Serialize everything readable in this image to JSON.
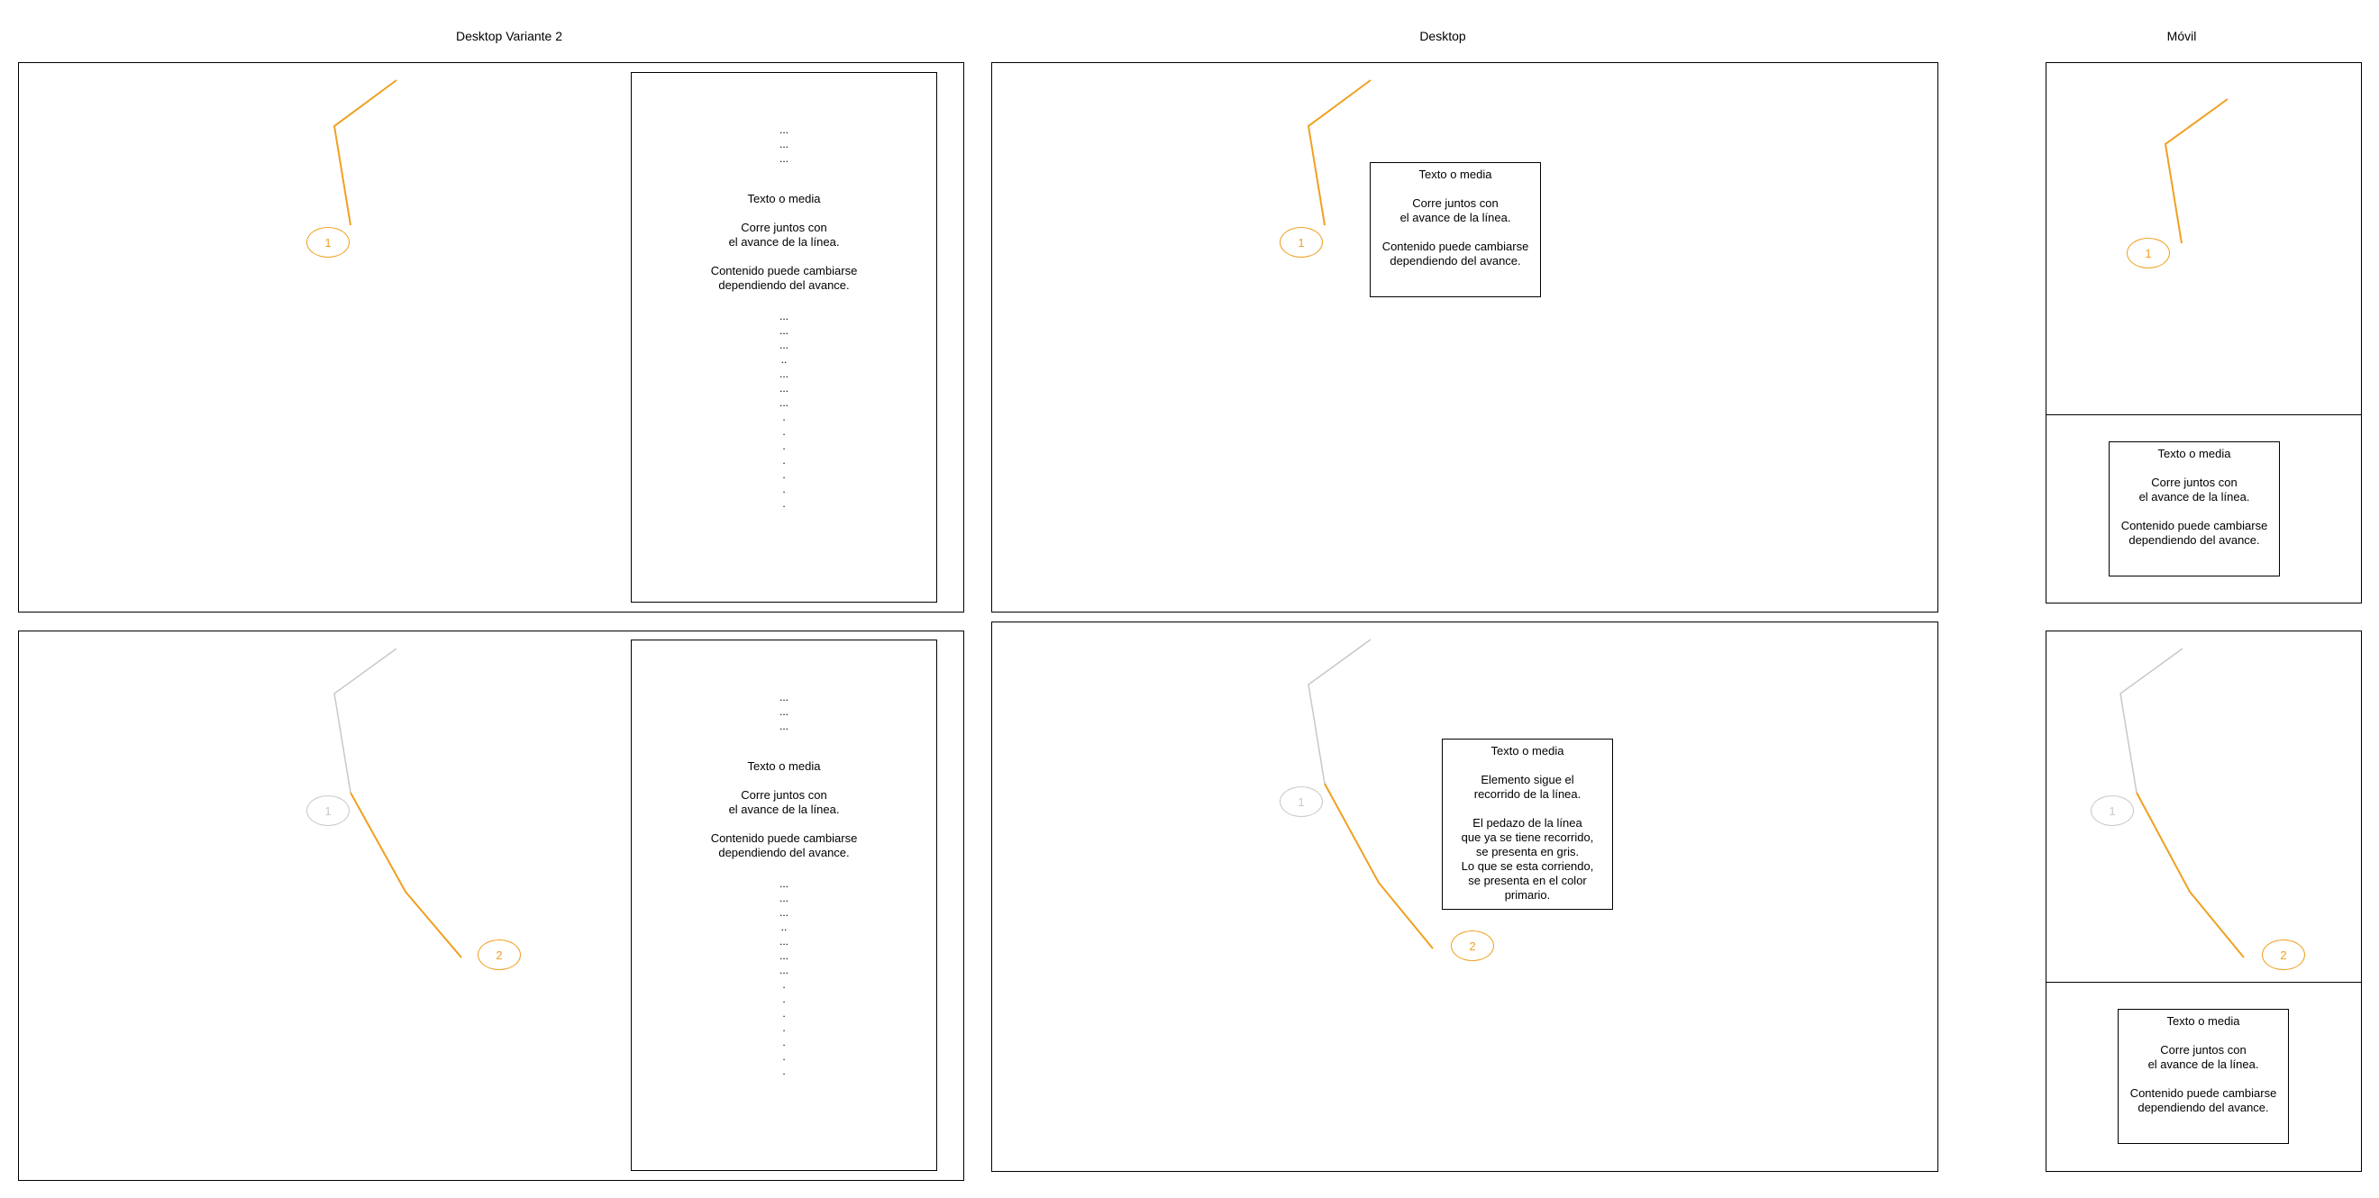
{
  "colors": {
    "primary": "#F0A020",
    "done": "#c8c8c8",
    "frame": "#000000"
  },
  "columns": {
    "variant2": "Desktop Variante 2",
    "desktop": "Desktop",
    "mobile": "Móvil"
  },
  "markers": {
    "one": "1",
    "two": "2"
  },
  "dots_top": "...\n...\n...",
  "dots_bottom": "...\n...\n...\n..\n...\n...\n...\n.\n.\n.\n.\n.\n.\n.",
  "cards": {
    "standard": {
      "title": "Texto o media",
      "line1": "Corre juntos con\nel avance de la línea.",
      "line2": "Contenido puede cambiarse\ndependiendo del avance."
    },
    "follow": {
      "title": "Texto o media",
      "line1": "Elemento sigue el\nrecorrido de la línea.",
      "line2": "El pedazo de la línea\nque ya se tiene recorrido,\nse presenta en gris.\nLo que se esta corriendo,\nse presenta en el color\nprimario."
    }
  }
}
